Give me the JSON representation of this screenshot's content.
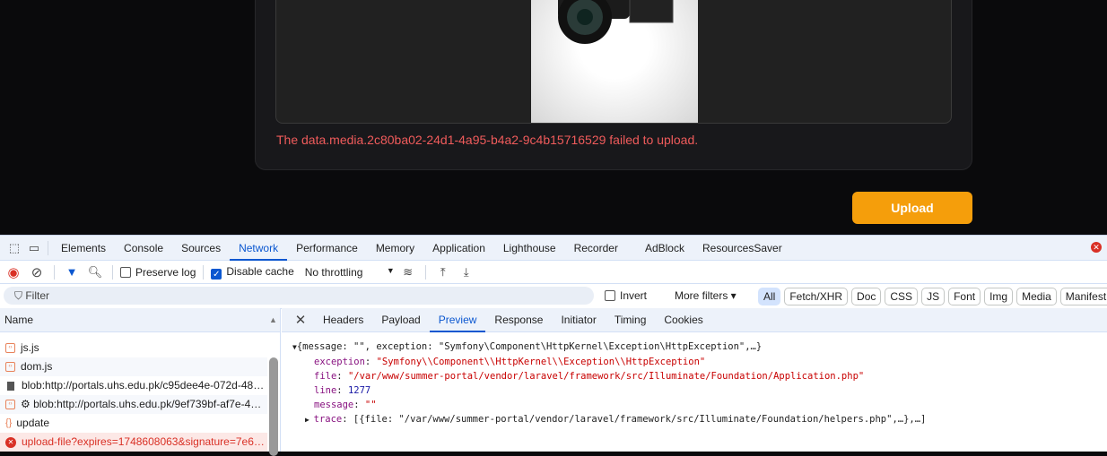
{
  "page": {
    "error_message": "The data.media.2c80ba02-24d1-4a95-b4a2-9c4b15716529 failed to upload.",
    "upload_button": "Upload"
  },
  "devtools": {
    "tabs": [
      "Elements",
      "Console",
      "Sources",
      "Network",
      "Performance",
      "Memory",
      "Application",
      "Lighthouse",
      "Recorder",
      "AdBlock",
      "ResourcesSaver"
    ],
    "active_tab": "Network",
    "toolbar": {
      "preserve_log": "Preserve log",
      "disable_cache": "Disable cache",
      "throttling": "No throttling"
    },
    "filter": {
      "placeholder": "Filter",
      "invert": "Invert",
      "more_filters": "More filters",
      "types": [
        "All",
        "Fetch/XHR",
        "Doc",
        "CSS",
        "JS",
        "Font",
        "Img",
        "Media",
        "Manifest"
      ]
    },
    "name_header": "Name",
    "requests": [
      "js.js",
      "dom.js",
      "blob:http://portals.uhs.edu.pk/c95dee4e-072d-48…",
      "⚙ blob:http://portals.uhs.edu.pk/9ef739bf-af7e-4…",
      "update",
      "upload-file?expires=1748608063&signature=7e6…"
    ],
    "detail_tabs": [
      "Headers",
      "Payload",
      "Preview",
      "Response",
      "Initiator",
      "Timing",
      "Cookies"
    ],
    "preview": {
      "summary": "{message: \"\", exception: \"Symfony\\Component\\HttpKernel\\Exception\\HttpException\",…}",
      "exception_key": "exception",
      "exception_val": "\"Symfony\\\\Component\\\\HttpKernel\\\\Exception\\\\HttpException\"",
      "file_key": "file",
      "file_val": "\"/var/www/summer-portal/vendor/laravel/framework/src/Illuminate/Foundation/Application.php\"",
      "line_key": "line",
      "line_val": "1277",
      "message_key": "message",
      "message_val": "\"\"",
      "trace_key": "trace",
      "trace_val": "[{file: \"/var/www/summer-portal/vendor/laravel/framework/src/Illuminate/Foundation/helpers.php\",…},…]"
    }
  }
}
